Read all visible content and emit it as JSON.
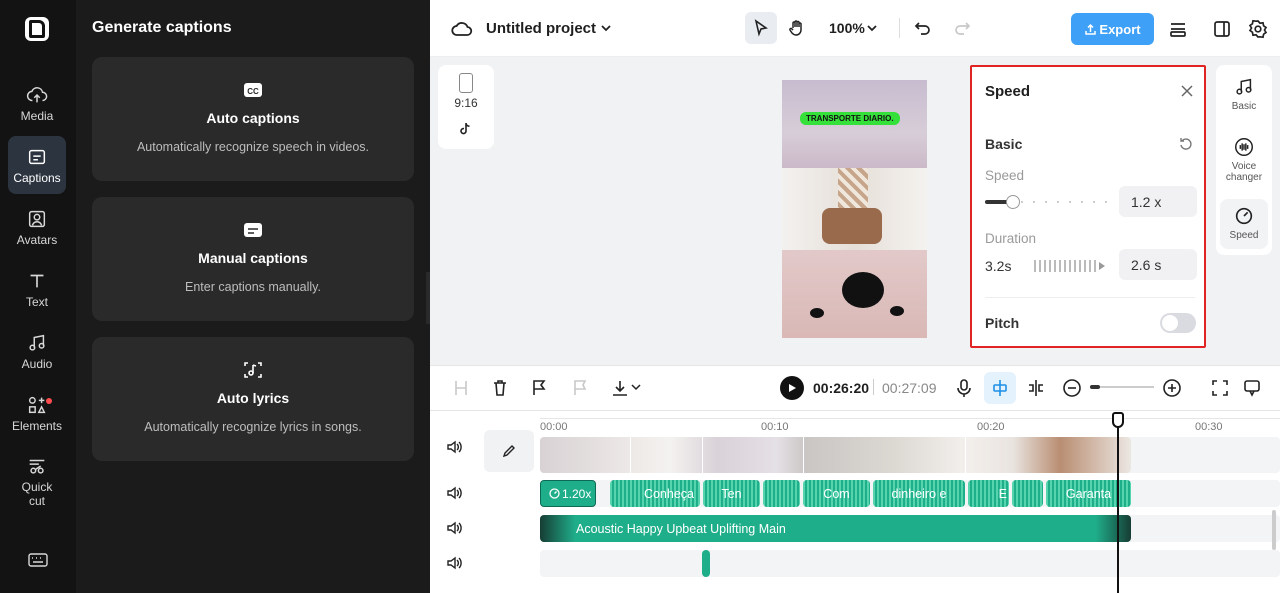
{
  "rail": {
    "items": [
      {
        "label": "Media",
        "icon": "cloud-upload-icon"
      },
      {
        "label": "Captions",
        "icon": "captions-icon",
        "active": true
      },
      {
        "label": "Avatars",
        "icon": "avatar-icon"
      },
      {
        "label": "Text",
        "icon": "text-icon"
      },
      {
        "label": "Audio",
        "icon": "music-note-icon"
      },
      {
        "label": "Elements",
        "icon": "elements-icon"
      },
      {
        "label": "Quick cut",
        "icon": "quick-cut-icon"
      }
    ],
    "keyboard_icon": "keyboard-icon"
  },
  "panel": {
    "title": "Generate captions",
    "cards": [
      {
        "title": "Auto captions",
        "desc": "Automatically recognize speech in videos.",
        "icon": "cc-icon"
      },
      {
        "title": "Manual captions",
        "desc": "Enter captions manually.",
        "icon": "keyboard-captions-icon"
      },
      {
        "title": "Auto lyrics",
        "desc": "Automatically recognize lyrics in songs.",
        "icon": "lyrics-scan-icon"
      }
    ]
  },
  "topbar": {
    "project_name": "Untitled project",
    "zoom": "100%",
    "export_label": "Export"
  },
  "canvas": {
    "aspect_ratio": "9:16",
    "preview_tag": "TRANSPORTE DIARIO."
  },
  "speed_panel": {
    "title": "Speed",
    "section": "Basic",
    "speed_label": "Speed",
    "speed_value": "1.2 x",
    "speed_slider_fraction": 0.23,
    "duration_label": "Duration",
    "duration_current": "3.2s",
    "duration_value": "2.6 s",
    "pitch_label": "Pitch",
    "pitch_on": false,
    "border_color": "#e02424"
  },
  "right_tools": [
    {
      "label": "Basic",
      "icon": "music-note-icon"
    },
    {
      "label": "Voice changer",
      "icon": "voice-wave-icon"
    },
    {
      "label": "Speed",
      "icon": "speedometer-icon",
      "active": true
    }
  ],
  "timeline_toolbar": {
    "current_time": "00:26:20",
    "total_time": "00:27:09"
  },
  "timeline": {
    "ruler": [
      "00:00",
      "00:10",
      "00:20",
      "00:30"
    ],
    "speed_badge": "1.20x",
    "caption_clips": [
      "Conheça",
      "Ten",
      "Com",
      "dinheiro e",
      "E",
      "Garanta"
    ],
    "audio_clip": "Acoustic Happy Upbeat Uplifting Main",
    "accent": "#1fae8a"
  }
}
